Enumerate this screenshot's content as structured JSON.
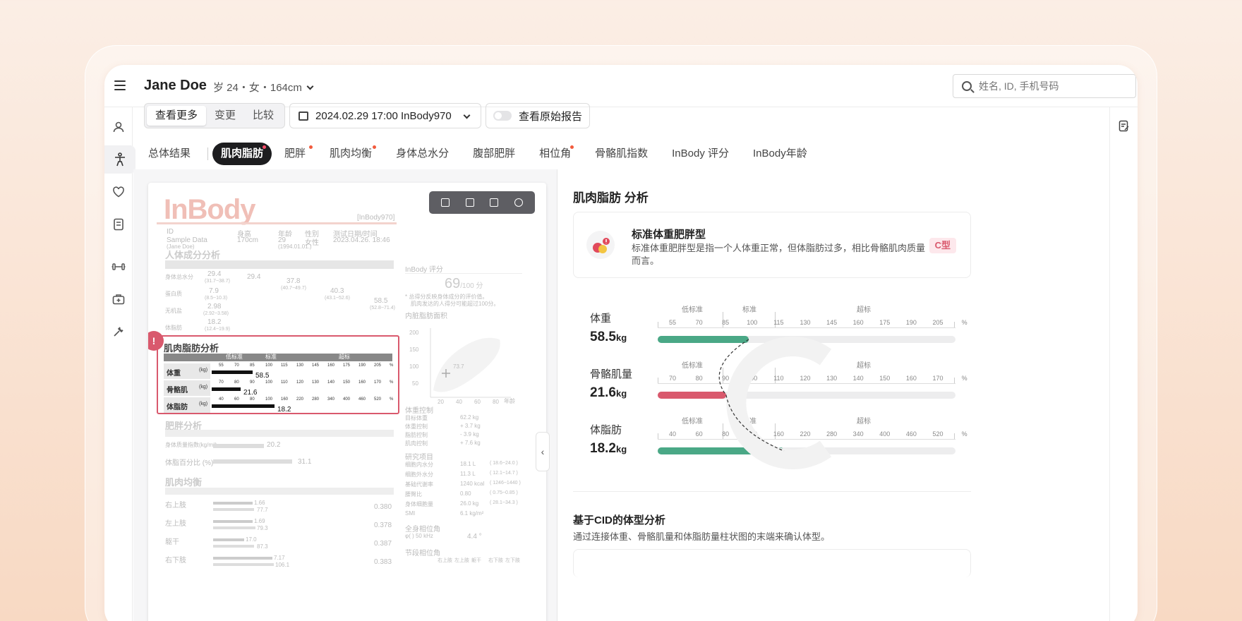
{
  "header": {
    "user_name": "Jane Doe",
    "user_meta": "岁 24・女・164cm",
    "search_placeholder": "姓名, ID, 手机号码"
  },
  "toolbar": {
    "segments": [
      "查看更多",
      "变更",
      "比较"
    ],
    "date_label": "2024.02.29 17:00  InBody970",
    "toggle_label": "查看原始报告"
  },
  "tabs": [
    {
      "label": "总体结果",
      "dot": false
    },
    {
      "label": "肌肉脂肪",
      "dot": true
    },
    {
      "label": "肥胖",
      "dot": true
    },
    {
      "label": "肌肉均衡",
      "dot": true
    },
    {
      "label": "身体总水分",
      "dot": false
    },
    {
      "label": "腹部肥胖",
      "dot": false
    },
    {
      "label": "相位角",
      "dot": true
    },
    {
      "label": "骨骼肌指数",
      "dot": false
    },
    {
      "label": "InBody 评分",
      "dot": false
    },
    {
      "label": "InBody年龄",
      "dot": false
    }
  ],
  "report": {
    "logo": "InBody",
    "model": "[InBody970]",
    "id_labels": [
      "ID",
      "身高",
      "年龄",
      "性别",
      "测试日期/时间"
    ],
    "id_values": [
      "Sample Data",
      "170cm",
      "29",
      "女性",
      "2023.04.26. 18:46"
    ],
    "id_extra": [
      "(Jane Doe)",
      "(1994.01.01.)"
    ],
    "composition_title": "人体成分分析",
    "composition_rows": [
      {
        "label": "身体总水分",
        "kg": "L",
        "value": "29.4",
        "range": "(31.7~38.7)"
      },
      {
        "label": "蛋白质",
        "kg": "kg",
        "value": "7.9",
        "range": "(8.5~10.3)"
      },
      {
        "label": "无机盐",
        "kg": "kg",
        "value": "2.98",
        "range": "(2.92~3.58)"
      },
      {
        "label": "体脂肪",
        "kg": "kg",
        "value": "18.2",
        "range": "(12.4~19.9)"
      }
    ],
    "composition_mid": [
      "29.4",
      "37.8",
      "(40.7~49.7)",
      "40.3",
      "(43.1~52.6)",
      "58.5",
      "(52.8~71.4)"
    ],
    "score_title": "InBody 评分",
    "score": "69",
    "score_max": "/100 分",
    "score_note": [
      "* 总得分反映身体成分的评价值。",
      "肌肉发达的人得分可能超过100分。"
    ],
    "vfa_title": "内脏脂肪面积",
    "vfa_axis": [
      "200",
      "150",
      "100",
      "50"
    ],
    "vfa_x": [
      "20",
      "40",
      "60",
      "80"
    ],
    "vfa_xunit": "年龄",
    "vfa_value": "73.7",
    "analysis_title": "肌肉脂肪分析",
    "analysis_heads": [
      "低标准",
      "标准",
      "超标"
    ],
    "analysis_rows": [
      {
        "label": "体重",
        "unit": "(kg)",
        "ticks": [
          "55",
          "70",
          "85",
          "100",
          "115",
          "130",
          "145",
          "160",
          "175",
          "190",
          "205",
          "%"
        ],
        "value": "58.5",
        "fill": 0.24
      },
      {
        "label": "骨骼肌",
        "unit": "(kg)",
        "ticks": [
          "70",
          "80",
          "90",
          "100",
          "110",
          "120",
          "130",
          "140",
          "150",
          "160",
          "170",
          "%"
        ],
        "value": "21.6",
        "fill": 0.17
      },
      {
        "label": "体脂肪",
        "unit": "(kg)",
        "ticks": [
          "40",
          "60",
          "80",
          "100",
          "160",
          "220",
          "280",
          "340",
          "400",
          "460",
          "520",
          "%"
        ],
        "value": "18.2",
        "fill": 0.37
      }
    ],
    "obesity_title": "肥胖分析",
    "obesity_rows": [
      {
        "label": "身体质量指数(kg/m²)",
        "value": "20.2"
      },
      {
        "label": "体脂百分比 (%)",
        "value": "31.1"
      }
    ],
    "balance_title": "肌肉均衡",
    "balance_rows": [
      {
        "label": "右上肢",
        "v1": "1.66",
        "v2": "77.7",
        "r": "0.380"
      },
      {
        "label": "左上肢",
        "v1": "1.69",
        "v2": "79.3",
        "r": "0.378"
      },
      {
        "label": "躯干",
        "v1": "17.0",
        "v2": "87.3",
        "r": "0.387"
      },
      {
        "label": "右下肢",
        "v1": "7.17",
        "v2": "106.1",
        "r": "0.383"
      }
    ],
    "control_title": "体重控制",
    "control_rows": [
      {
        "label": "目标体重",
        "value": "62.2  kg"
      },
      {
        "label": "体重控制",
        "value": "+ 3.7  kg"
      },
      {
        "label": "脂肪控制",
        "value": "- 3.9  kg"
      },
      {
        "label": "肌肉控制",
        "value": "+ 7.6  kg"
      }
    ],
    "research_title": "研究项目",
    "research_rows": [
      {
        "label": "细胞内水分",
        "value": "18.1 L",
        "range": "( 18.6~24.0 )"
      },
      {
        "label": "细胞外水分",
        "value": "11.3 L",
        "range": "( 12.1~14.7 )"
      },
      {
        "label": "基础代谢率",
        "value": "1240 kcal",
        "range": "( 1246~1440 )"
      },
      {
        "label": "腰臀比",
        "value": "0.80",
        "range": "( 0.75~0.85 )"
      },
      {
        "label": "身体细胞量",
        "value": "26.0 kg",
        "range": "( 28.1~34.3 )"
      },
      {
        "label": "SMI",
        "value": "6.1 kg/m²",
        "range": ""
      }
    ],
    "phase_title": "全身相位角",
    "phase_value": "4.4 °",
    "phase_freq": "φ( ) 50 kHz",
    "segment_phase_title": "节段相位角",
    "segment_heads": [
      "右上肢",
      "左上肢",
      "躯干",
      "右下肢",
      "左下肢"
    ]
  },
  "panel": {
    "title": "肌肉脂肪 分析",
    "card": {
      "title": "标准体重肥胖型",
      "desc": "标准体重肥胖型是指一个人体重正常，但体脂肪过多，相比骨骼肌肉质量而言。",
      "badge": "C型"
    },
    "metrics": [
      {
        "label": "体重",
        "value": "58.5",
        "unit": "kg",
        "ticks": [
          "55",
          "70",
          "85",
          "100",
          "115",
          "130",
          "145",
          "160",
          "175",
          "190",
          "205",
          "%"
        ],
        "fill": 0.305,
        "color": "#4aa886"
      },
      {
        "label": "骨骼肌量",
        "value": "21.6",
        "unit": "kg",
        "ticks": [
          "70",
          "80",
          "90",
          "100",
          "110",
          "120",
          "130",
          "140",
          "150",
          "160",
          "170",
          "%"
        ],
        "fill": 0.23,
        "color": "#d9596d"
      },
      {
        "label": "体脂肪",
        "value": "18.2",
        "unit": "kg",
        "ticks": [
          "40",
          "60",
          "80",
          "100",
          "160",
          "220",
          "280",
          "340",
          "400",
          "460",
          "520",
          "%"
        ],
        "fill": 0.425,
        "color": "#4aa886"
      }
    ],
    "scale_heads": [
      "低标准",
      "标准",
      "超标"
    ],
    "cid_title": "基于CID的体型分析",
    "cid_desc": "通过连接体重、骨骼肌量和体脂肪量柱状图的末端来确认体型。"
  },
  "colors": {
    "accent_dark": "#1d1d1f",
    "alert": "#d9596d",
    "good": "#4aa886",
    "bg": "#fbeee5"
  }
}
